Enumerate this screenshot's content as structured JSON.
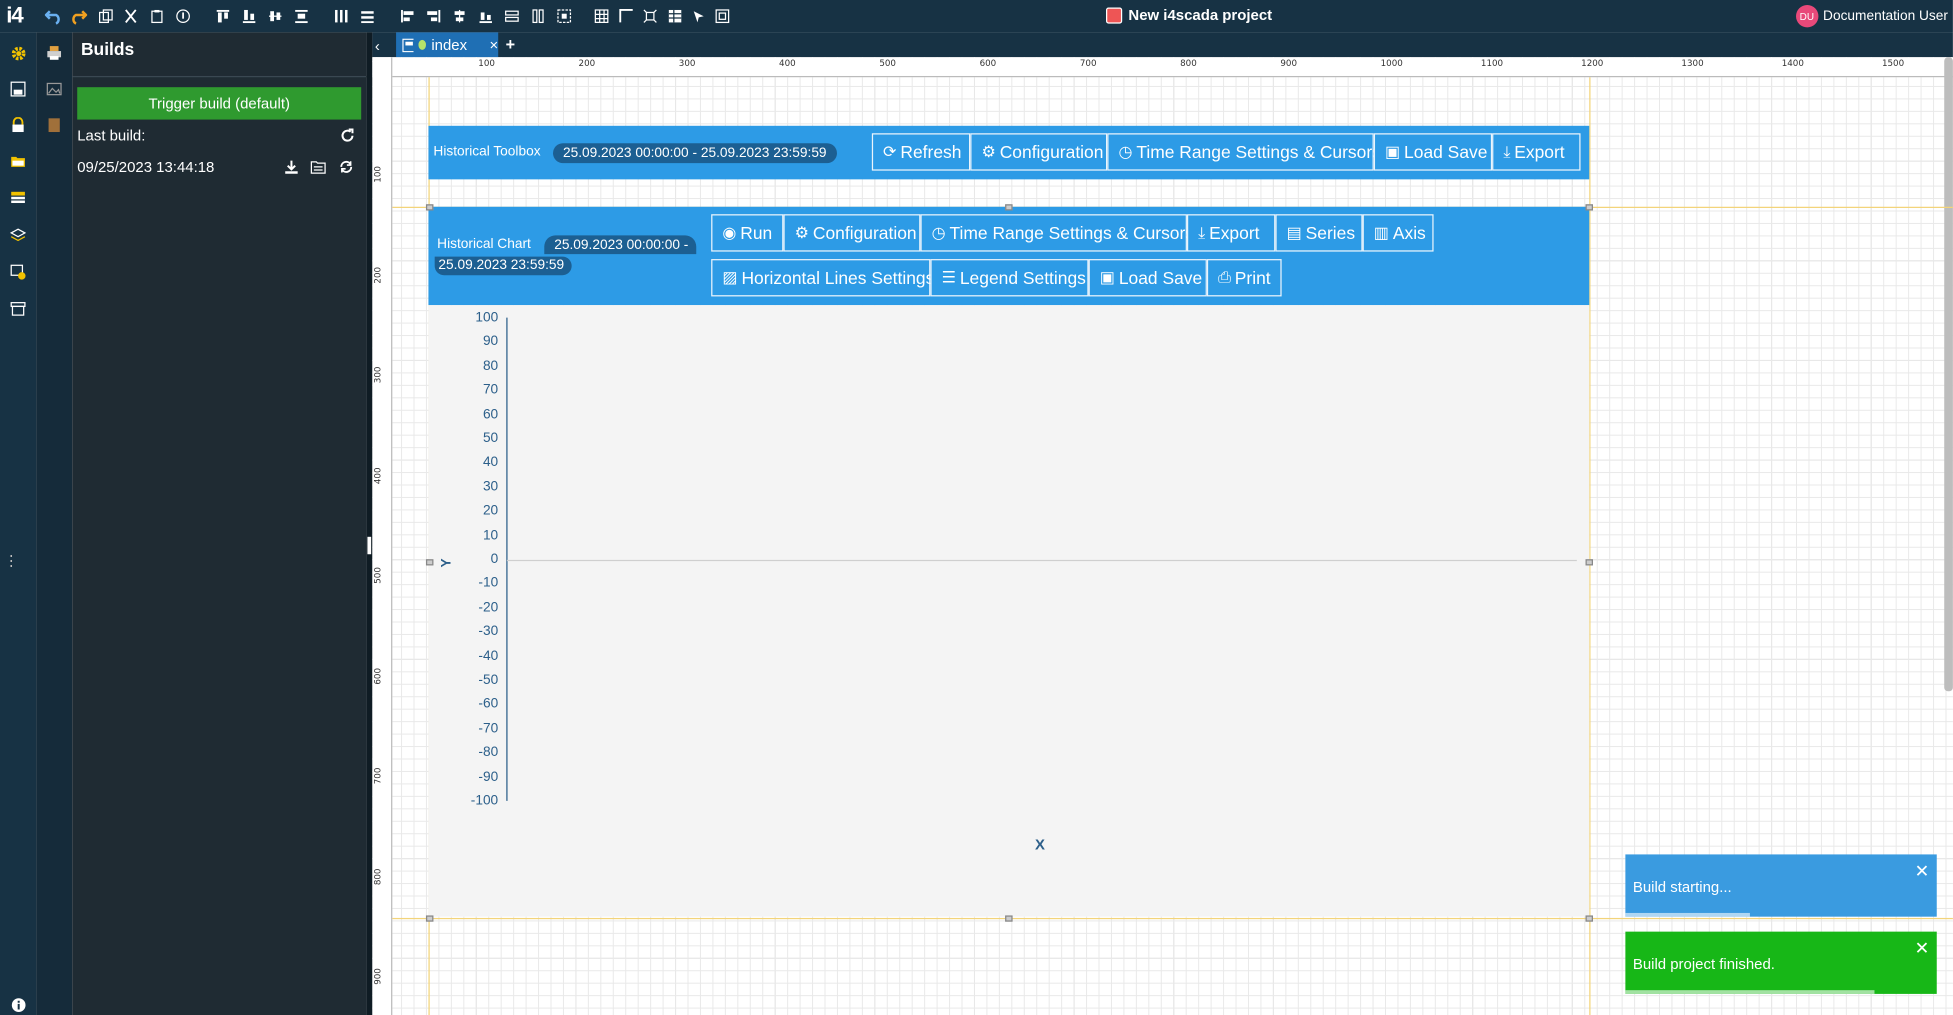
{
  "app": {
    "logo": "i4",
    "project_title": "New i4scada project",
    "user": {
      "initials": "DU",
      "name": "Documentation User"
    }
  },
  "builds": {
    "title": "Builds",
    "trigger_button": "Trigger build (default)",
    "last_build_label": "Last build:",
    "last_build_date": "09/25/2023 13:44:18"
  },
  "tabs": [
    {
      "label": "index",
      "close": "×"
    }
  ],
  "tab_add": "+",
  "rulers": {
    "horizontal": [
      "100",
      "200",
      "300",
      "400",
      "500",
      "600",
      "700",
      "800",
      "900",
      "1000",
      "1100",
      "1200",
      "1300",
      "1400",
      "1500"
    ],
    "vertical": [
      "100",
      "200",
      "300",
      "400",
      "500",
      "600",
      "700",
      "800",
      "900"
    ]
  },
  "historical_toolbox": {
    "label": "Historical Toolbox",
    "range": "25.09.2023 00:00:00 - 25.09.2023 23:59:59",
    "buttons": [
      "Refresh",
      "Configuration",
      "Time Range Settings & Cursors",
      "Load Save",
      "Export"
    ]
  },
  "historical_chart": {
    "label": "Historical Chart",
    "range_line1": "25.09.2023 00:00:00 -",
    "range_line2": "25.09.2023 23:59:59",
    "buttons_row1": [
      "Run",
      "Configuration",
      "Time Range Settings & Cursors",
      "Export",
      "Series",
      "Axis"
    ],
    "buttons_row2": [
      "Horizontal Lines Settings",
      "Legend Settings",
      "Load Save",
      "Print"
    ]
  },
  "chart_data": {
    "type": "line",
    "xlabel": "X",
    "ylabel": "Y",
    "ylim": [
      -100,
      100
    ],
    "yticks": [
      "100",
      "90",
      "80",
      "70",
      "60",
      "50",
      "40",
      "30",
      "20",
      "10",
      "0",
      "-10",
      "-20",
      "-30",
      "-40",
      "-50",
      "-60",
      "-70",
      "-80",
      "-90",
      "-100"
    ],
    "series": []
  },
  "toasts": [
    {
      "text": "Build starting...",
      "color": "#3a9be0",
      "progress": 0.5
    },
    {
      "text": "Build project finished.",
      "color": "#17b717",
      "progress": 1.0
    }
  ],
  "colors": {
    "accent": "#2d9be6",
    "topbar": "#173244",
    "success": "#2f9a2f"
  }
}
